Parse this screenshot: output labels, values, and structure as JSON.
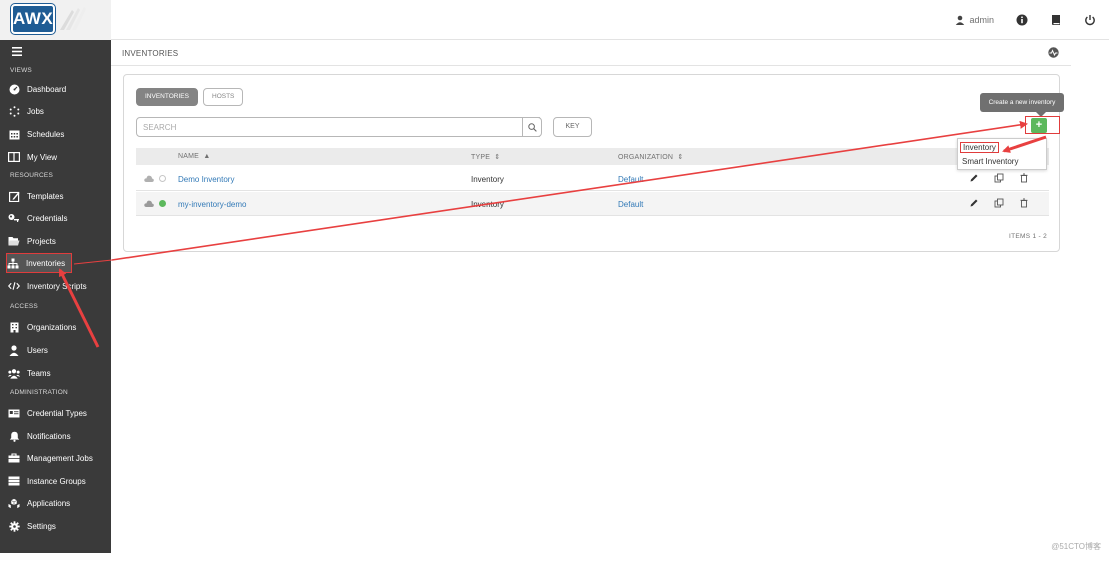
{
  "topbar": {
    "logo_text": "AWX",
    "user_name": "admin",
    "icons": [
      "user-icon",
      "info-icon",
      "docs-icon",
      "power-icon"
    ]
  },
  "sidebar": {
    "sections": {
      "views": "VIEWS",
      "resources": "RESOURCES",
      "access": "ACCESS",
      "administration": "ADMINISTRATION"
    },
    "items": [
      {
        "label": "Dashboard",
        "icon": "dashboard-icon"
      },
      {
        "label": "Jobs",
        "icon": "jobs-icon"
      },
      {
        "label": "Schedules",
        "icon": "calendar-icon"
      },
      {
        "label": "My View",
        "icon": "columns-icon"
      },
      {
        "label": "Templates",
        "icon": "pencil-square-icon"
      },
      {
        "label": "Credentials",
        "icon": "key-icon"
      },
      {
        "label": "Projects",
        "icon": "folder-icon"
      },
      {
        "label": "Inventories",
        "icon": "sitemap-icon"
      },
      {
        "label": "Inventory Scripts",
        "icon": "code-icon"
      },
      {
        "label": "Organizations",
        "icon": "building-icon"
      },
      {
        "label": "Users",
        "icon": "user-icon"
      },
      {
        "label": "Teams",
        "icon": "users-icon"
      },
      {
        "label": "Credential Types",
        "icon": "id-card-icon"
      },
      {
        "label": "Notifications",
        "icon": "bell-icon"
      },
      {
        "label": "Management Jobs",
        "icon": "briefcase-icon"
      },
      {
        "label": "Instance Groups",
        "icon": "server-icon"
      },
      {
        "label": "Applications",
        "icon": "cubes-icon"
      },
      {
        "label": "Settings",
        "icon": "gear-icon"
      }
    ]
  },
  "breadcrumb": "INVENTORIES",
  "panel": {
    "tabs": {
      "inventories": "INVENTORIES",
      "hosts": "HOSTS"
    },
    "search_placeholder": "SEARCH",
    "key_label": "KEY",
    "columns": {
      "name": "NAME",
      "type": "TYPE",
      "organization": "ORGANIZATION"
    },
    "rows": [
      {
        "name": "Demo Inventory",
        "type": "Inventory",
        "organization": "Default",
        "status": "none"
      },
      {
        "name": "my-inventory-demo",
        "type": "Inventory",
        "organization": "Default",
        "status": "ok"
      }
    ],
    "items_count": "ITEMS  1 - 2"
  },
  "add": {
    "tooltip": "Create a new inventory",
    "button": "+",
    "menu": [
      "Inventory",
      "Smart Inventory"
    ]
  },
  "watermark": "@51CTO博客",
  "colors": {
    "sidebar_bg": "#3a3a3a",
    "add_green": "#5cb85c",
    "link_blue": "#337ab7",
    "status_green": "#5cb85c",
    "annotation_red": "#e03c3c"
  }
}
